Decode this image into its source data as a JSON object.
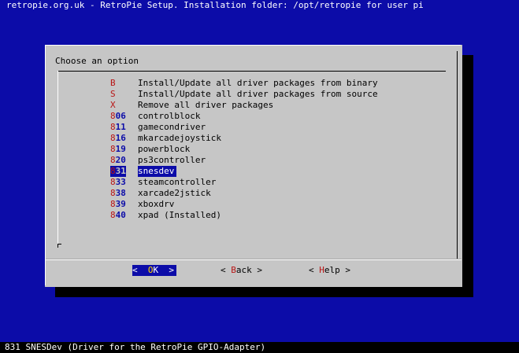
{
  "window": {
    "title": "retropie.org.uk - RetroPie Setup. Installation folder: /opt/retropie for user pi"
  },
  "dialog": {
    "prompt": "Choose an option",
    "menu": [
      {
        "tag_hot": "B",
        "tag_rest": "",
        "label": "Install/Update all driver packages from binary"
      },
      {
        "tag_hot": "S",
        "tag_rest": "",
        "label": "Install/Update all driver packages from source"
      },
      {
        "tag_hot": "X",
        "tag_rest": "",
        "label": "Remove all driver packages"
      },
      {
        "tag_hot": "8",
        "tag_rest": "06",
        "label": "controlblock"
      },
      {
        "tag_hot": "8",
        "tag_rest": "11",
        "label": "gamecondriver"
      },
      {
        "tag_hot": "8",
        "tag_rest": "16",
        "label": "mkarcadejoystick"
      },
      {
        "tag_hot": "8",
        "tag_rest": "19",
        "label": "powerblock"
      },
      {
        "tag_hot": "8",
        "tag_rest": "20",
        "label": "ps3controller"
      },
      {
        "tag_hot": "8",
        "tag_rest": "31",
        "label": "snesdev",
        "selected": true
      },
      {
        "tag_hot": "8",
        "tag_rest": "33",
        "label": "steamcontroller"
      },
      {
        "tag_hot": "8",
        "tag_rest": "38",
        "label": "xarcade2jstick"
      },
      {
        "tag_hot": "8",
        "tag_rest": "39",
        "label": "xboxdrv"
      },
      {
        "tag_hot": "8",
        "tag_rest": "40",
        "label": "xpad (Installed)"
      }
    ],
    "buttons": {
      "ok": {
        "pre": "<  ",
        "hot": "O",
        "rest": "K",
        "post": "  >"
      },
      "back": {
        "pre": "< ",
        "hot": "B",
        "rest": "ack",
        "post": " >"
      },
      "help": {
        "pre": "< ",
        "hot": "H",
        "rest": "elp",
        "post": " >"
      }
    }
  },
  "status_bar": {
    "text": "831 SNESDev (Driver for the RetroPie GPIO-Adapter)"
  },
  "colors": {
    "background": "#0c0ca8",
    "dialog": "#c6c6c6",
    "hotkey": "#b81414",
    "selection": "#0c0ca8"
  }
}
